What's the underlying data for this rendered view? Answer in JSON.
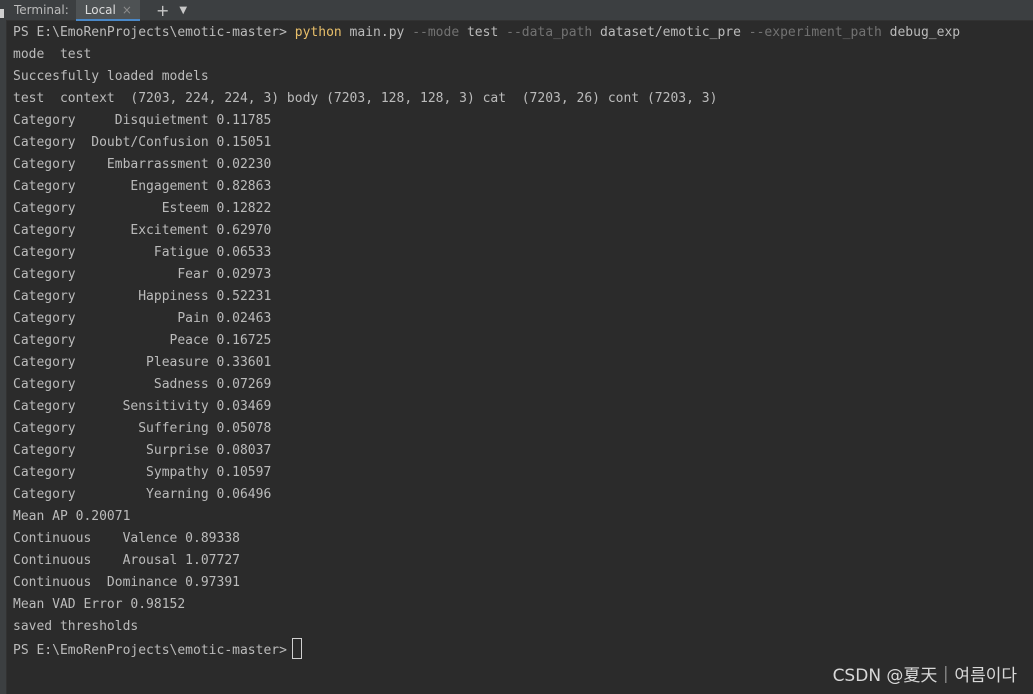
{
  "tabs": {
    "title": "Terminal:",
    "active": "Local",
    "close_icon": "×",
    "add_icon": "+",
    "more_icon": "⌄"
  },
  "command": {
    "prompt": "PS E:\\EmoRenProjects\\emotic-master> ",
    "program": "python",
    "script": " main.py ",
    "opt_mode": "--mode",
    "val_mode": " test ",
    "opt_data": "--data_path",
    "val_data": " dataset/emotic_pre ",
    "opt_exp": "--experiment_path",
    "val_exp": " debug_exp"
  },
  "output": [
    "mode  test",
    "Succesfully loaded models",
    "test  context  (7203, 224, 224, 3) body (7203, 128, 128, 3) cat  (7203, 26) cont (7203, 3)",
    "Category     Disquietment 0.11785",
    "Category  Doubt/Confusion 0.15051",
    "Category    Embarrassment 0.02230",
    "Category       Engagement 0.82863",
    "Category           Esteem 0.12822",
    "Category       Excitement 0.62970",
    "Category          Fatigue 0.06533",
    "Category             Fear 0.02973",
    "Category        Happiness 0.52231",
    "Category             Pain 0.02463",
    "Category            Peace 0.16725",
    "Category         Pleasure 0.33601",
    "Category          Sadness 0.07269",
    "Category      Sensitivity 0.03469",
    "Category        Suffering 0.05078",
    "Category         Surprise 0.08037",
    "Category         Sympathy 0.10597",
    "Category         Yearning 0.06496",
    "Mean AP 0.20071",
    "Continuous    Valence 0.89338",
    "Continuous    Arousal 1.07727",
    "Continuous  Dominance 0.97391",
    "Mean VAD Error 0.98152",
    "saved thresholds"
  ],
  "final_prompt": "PS E:\\EmoRenProjects\\emotic-master>",
  "watermark": "CSDN @夏天｜여름이다"
}
